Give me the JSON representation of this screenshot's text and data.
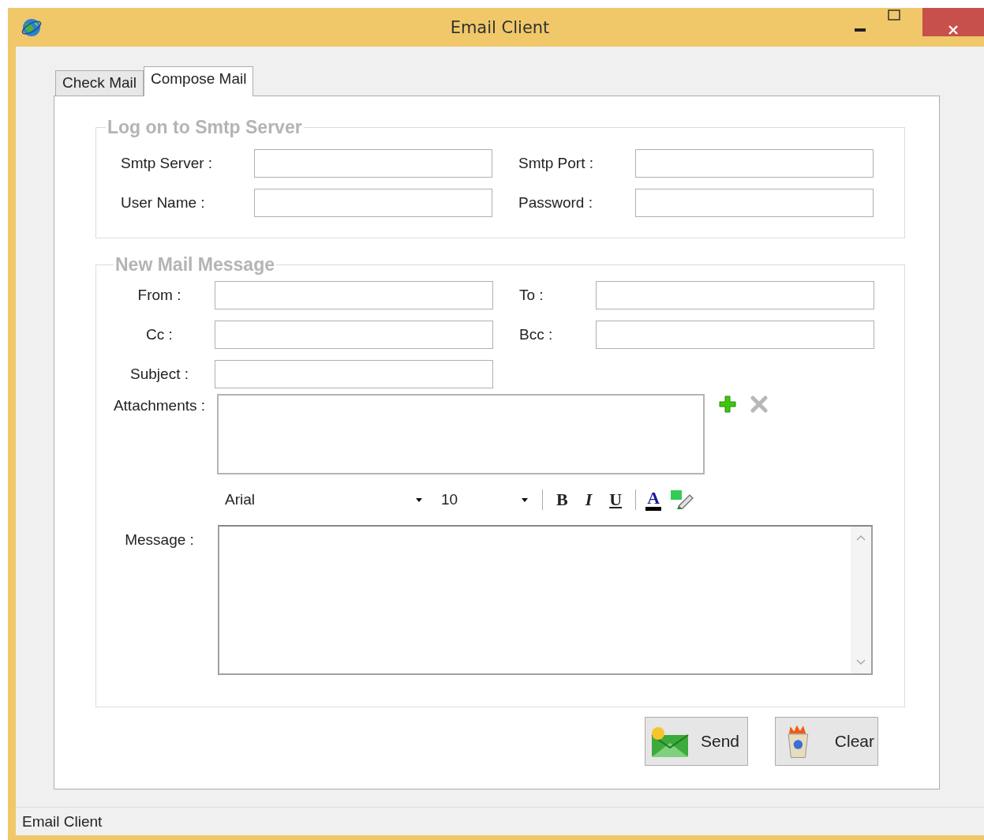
{
  "window": {
    "title": "Email Client"
  },
  "tabs": [
    {
      "label": "Check Mail",
      "selected": false
    },
    {
      "label": "Compose Mail",
      "selected": true
    }
  ],
  "smtp_group": {
    "title": "Log on to Smtp Server",
    "fields": [
      {
        "label": "Smtp Server :"
      },
      {
        "label": "Smtp Port :"
      },
      {
        "label": "User Name :"
      },
      {
        "label": "Password :"
      }
    ]
  },
  "message_group": {
    "title": "New Mail Message",
    "fields": [
      {
        "label": "From :"
      },
      {
        "label": "To :"
      },
      {
        "label": "Cc :"
      },
      {
        "label": "Bcc :"
      },
      {
        "label": "Subject :"
      }
    ],
    "attachments_label": "Attachments :",
    "font": {
      "name": "Arial",
      "size": "10"
    },
    "format_buttons": [
      "B",
      "I",
      "U"
    ],
    "font_color_button": "A",
    "message_label": "Message :"
  },
  "buttons": [
    {
      "label": "Send",
      "kind": "send"
    },
    {
      "label": "Clear",
      "kind": "clear"
    }
  ],
  "status_bar": {
    "text": "Email Client"
  }
}
